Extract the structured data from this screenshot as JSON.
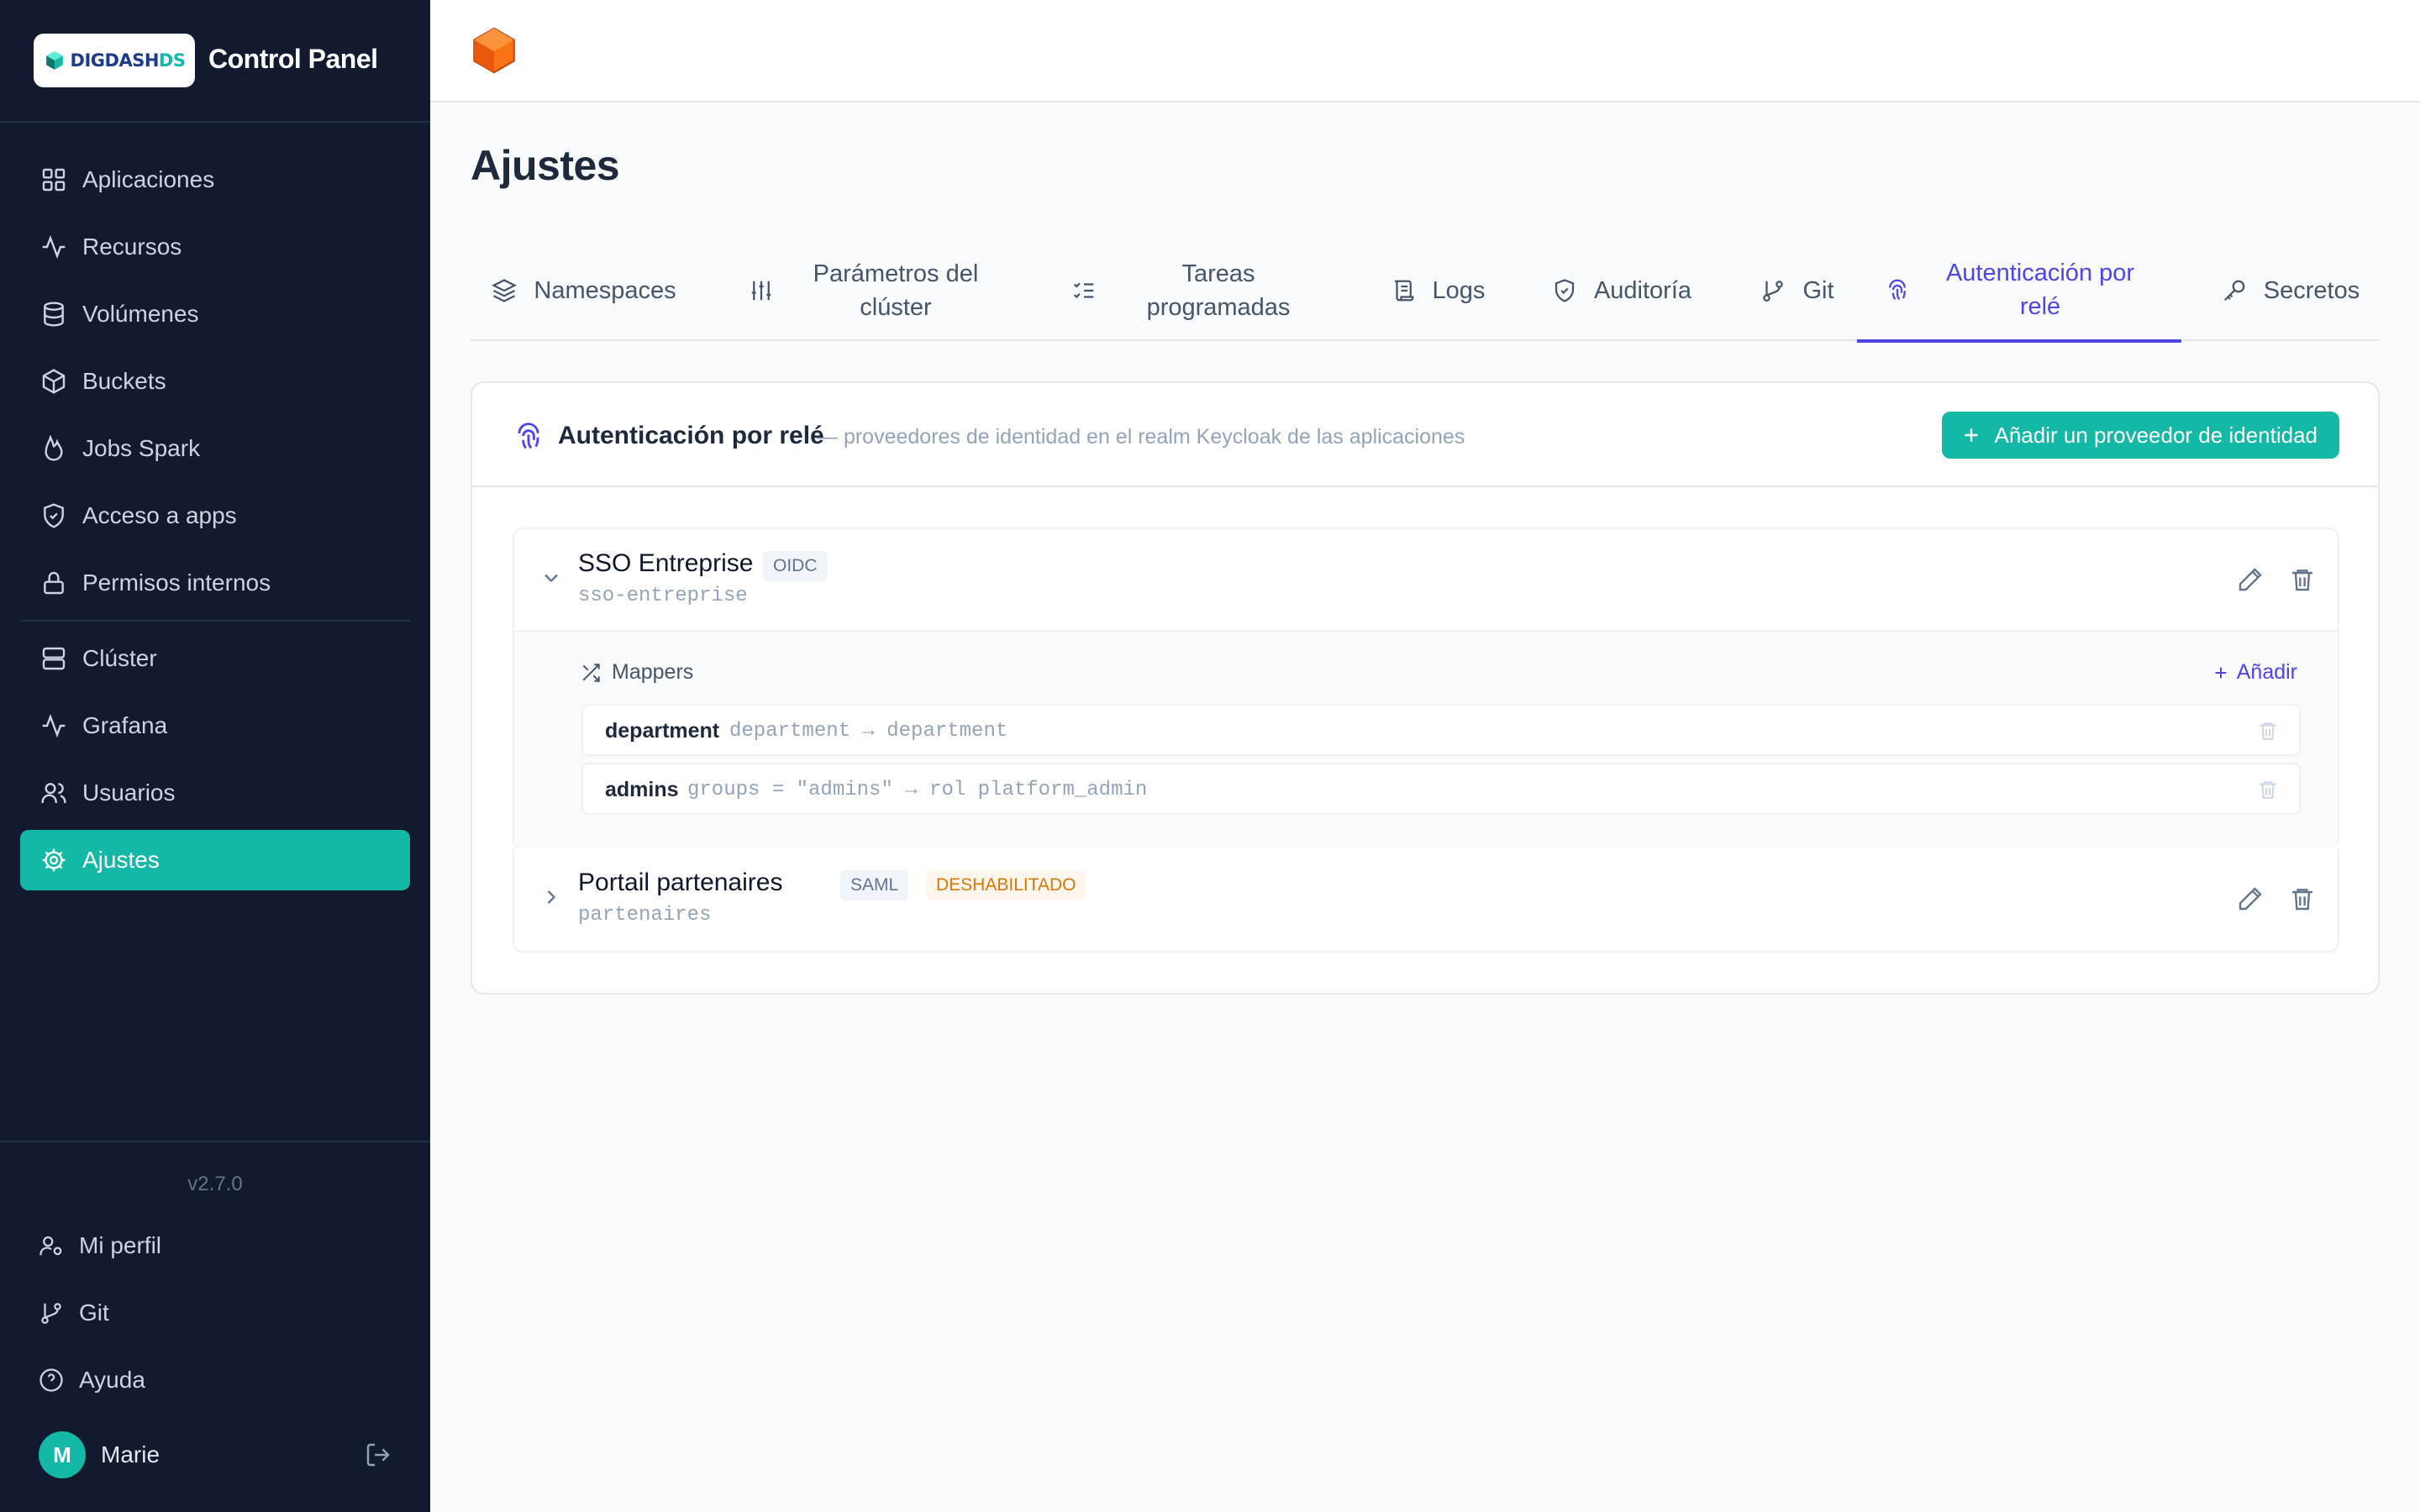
{
  "sidebar": {
    "logo_text_a": "DIGDASH",
    "logo_text_b": "DS",
    "title": "Control Panel",
    "items": [
      {
        "label": "Aplicaciones",
        "icon": "grid-icon"
      },
      {
        "label": "Recursos",
        "icon": "activity-icon"
      },
      {
        "label": "Volúmenes",
        "icon": "database-icon"
      },
      {
        "label": "Buckets",
        "icon": "box-icon"
      },
      {
        "label": "Jobs Spark",
        "icon": "flame-icon"
      },
      {
        "label": "Acceso a apps",
        "icon": "shield-check-icon"
      },
      {
        "label": "Permisos internos",
        "icon": "lock-icon"
      },
      {
        "label": "Clúster",
        "icon": "server-icon"
      },
      {
        "label": "Grafana",
        "icon": "activity-icon"
      },
      {
        "label": "Usuarios",
        "icon": "users-icon"
      },
      {
        "label": "Ajustes",
        "icon": "settings-icon",
        "active": true
      }
    ],
    "version": "v2.7.0",
    "footer": [
      {
        "label": "Mi perfil",
        "icon": "user-cog-icon"
      },
      {
        "label": "Git",
        "icon": "git-branch-icon"
      },
      {
        "label": "Ayuda",
        "icon": "help-circle-icon"
      }
    ],
    "user": {
      "initial": "M",
      "name": "Marie"
    }
  },
  "page": {
    "title": "Ajustes",
    "tabs": [
      {
        "label": "Namespaces",
        "icon": "layers-icon"
      },
      {
        "label": "Parámetros del clúster",
        "icon": "sliders-icon"
      },
      {
        "label": "Tareas programadas",
        "icon": "list-checks-icon"
      },
      {
        "label": "Logs",
        "icon": "scroll-icon"
      },
      {
        "label": "Auditoría",
        "icon": "shield-check-icon"
      },
      {
        "label": "Git",
        "icon": "git-branch-icon"
      },
      {
        "label": "Autenticación por relé",
        "icon": "fingerprint-icon",
        "active": true
      },
      {
        "label": "Secretos",
        "icon": "key-icon"
      }
    ]
  },
  "card": {
    "title": "Autenticación por relé",
    "subtitle": "— proveedores de identidad en el realm Keycloak de las aplicaciones",
    "add_button": "Añadir un proveedor de identidad"
  },
  "providers": [
    {
      "name": "SSO Entreprise",
      "id": "sso-entreprise",
      "type": "OIDC",
      "expanded": true,
      "mappers_title": "Mappers",
      "mappers_add": "Añadir",
      "mappers": [
        {
          "name": "department",
          "rule": "department → department"
        },
        {
          "name": "admins",
          "rule": "groups = \"admins\" → rol platform_admin"
        }
      ]
    },
    {
      "name": "Portail partenaires",
      "id": "partenaires",
      "type": "SAML",
      "status": "DESHABILITADO",
      "expanded": false
    }
  ],
  "colors": {
    "accent": "#14b8a6",
    "active_tab": "#4f46e5",
    "sidebar_bg": "#111a2e",
    "warning": "#d97706"
  }
}
